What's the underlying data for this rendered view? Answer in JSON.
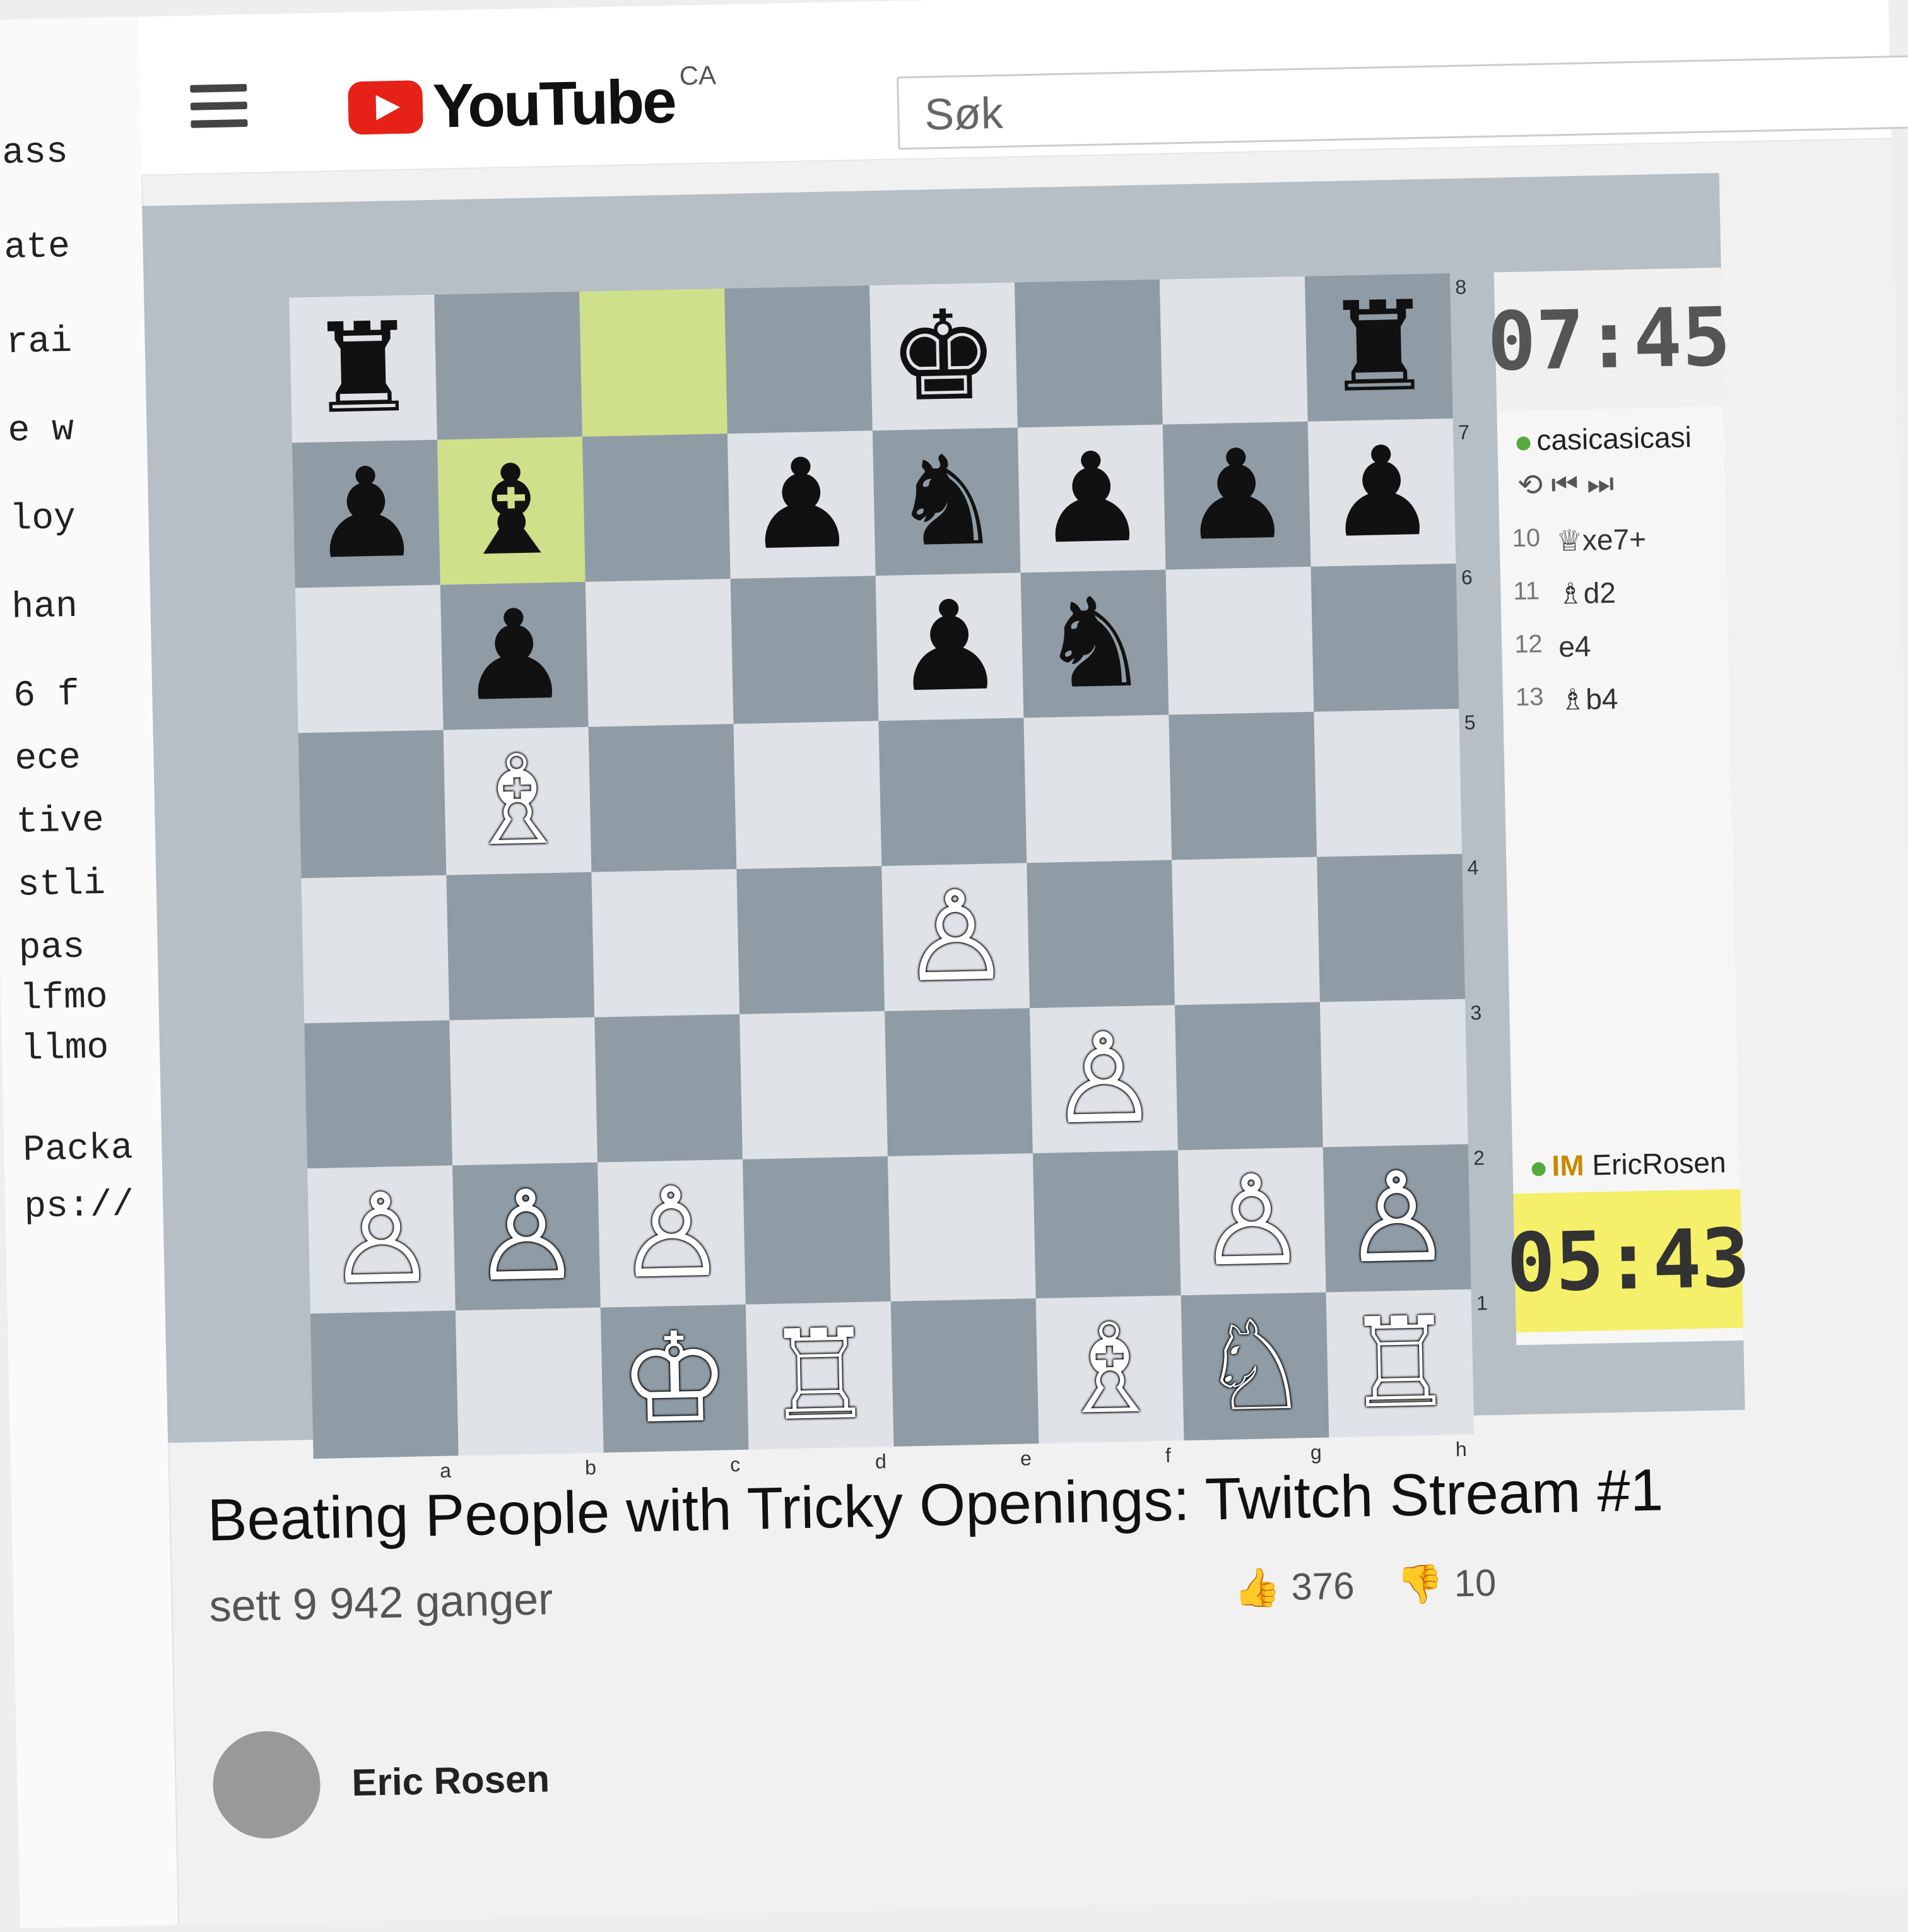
{
  "left_code_fragments": [
    "ass",
    "ate",
    "rai",
    "e w",
    "loy",
    "han",
    "6 f",
    "ece",
    "tive",
    "stli",
    "pas",
    "lfmo",
    "llmo",
    "Packa",
    "ps://"
  ],
  "header": {
    "menu_icon": "hamburger-icon",
    "logo_text": "YouTube",
    "country": "CA",
    "search_placeholder": "Søk"
  },
  "board": {
    "files": [
      "a",
      "b",
      "c",
      "d",
      "e",
      "f",
      "g",
      "h"
    ],
    "ranks": [
      "8",
      "7",
      "6",
      "5",
      "4",
      "3",
      "2",
      "1"
    ],
    "highlight_squares": [
      "c8",
      "b7"
    ],
    "pieces": {
      "a8": "♜",
      "e8": "♚",
      "h8": "♜",
      "a7": "♟",
      "b7": "♝",
      "d7": "♟",
      "e7": "♞",
      "f7": "♟",
      "g7": "♟",
      "h7": "♟",
      "b6": "♟",
      "e6": "♟",
      "f6": "♞",
      "b5": "♗",
      "e4": "♙",
      "f3": "♙",
      "a2": "♙",
      "b2": "♙",
      "c2": "♙",
      "g2": "♙",
      "h2": "♙",
      "c1": "♔",
      "d1": "♖",
      "f1": "♗",
      "g1": "♘",
      "h1": "♖"
    }
  },
  "sidepanel": {
    "top_clock": "07:45",
    "top_player": "casicasicasi",
    "controls": "⟲  ⏮  ⏭",
    "moves": [
      {
        "num": "10",
        "san": "♕xe7+"
      },
      {
        "num": "11",
        "san": "♗d2"
      },
      {
        "num": "12",
        "san": "e4"
      },
      {
        "num": "13",
        "san": "♗b4"
      }
    ],
    "bottom_player_title": "IM",
    "bottom_player": "EricRosen",
    "bottom_clock": "05:43"
  },
  "video": {
    "title": "Beating People with Tricky Openings: Twitch Stream #1",
    "views": "sett 9 942 ganger",
    "likes": "376",
    "dislikes": "10",
    "channel": "Eric Rosen"
  }
}
